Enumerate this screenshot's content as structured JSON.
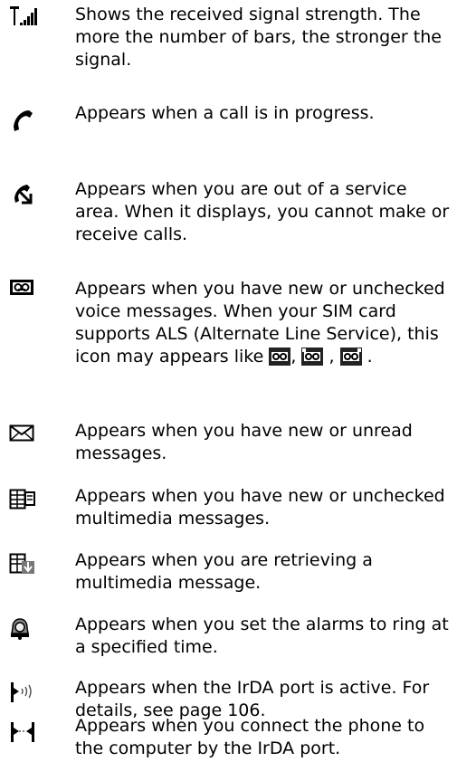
{
  "items": [
    {
      "icon": "signal-strength-icon",
      "text": "Shows the received signal strength. The more the number of bars, the stronger the signal."
    },
    {
      "icon": "call-in-progress-icon",
      "text": "Appears when a call is in progress."
    },
    {
      "icon": "no-service-icon",
      "text": "Appears when you are out of a service area. When it displays, you cannot make or receive calls."
    },
    {
      "icon": "voicemail-icon",
      "text_main": "Appears when you have new or unchecked voice messages. When your SIM card supports ALS (Alternate Line Service), this icon may appears like",
      "sep1": ",",
      "sep2": ",",
      "end": ".",
      "inline_icons": [
        "voicemail-line-icon",
        "voicemail-line1-icon",
        "voicemail-line2-icon"
      ]
    },
    {
      "icon": "new-message-icon",
      "text": "Appears when you have new or unread messages."
    },
    {
      "icon": "multimedia-message-icon",
      "text": "Appears when you have new or unchecked multimedia messages."
    },
    {
      "icon": "retrieving-mms-icon",
      "text": "Appears when you are retrieving a multimedia message."
    },
    {
      "icon": "alarm-icon",
      "text": "Appears when you set the alarms to ring at a specified time."
    },
    {
      "icon": "irda-active-icon",
      "text": "Appears when the IrDA port is active. For details, see page 106."
    },
    {
      "icon": "irda-connected-icon",
      "text": "Appears when you connect the phone to the computer by the IrDA port."
    }
  ]
}
